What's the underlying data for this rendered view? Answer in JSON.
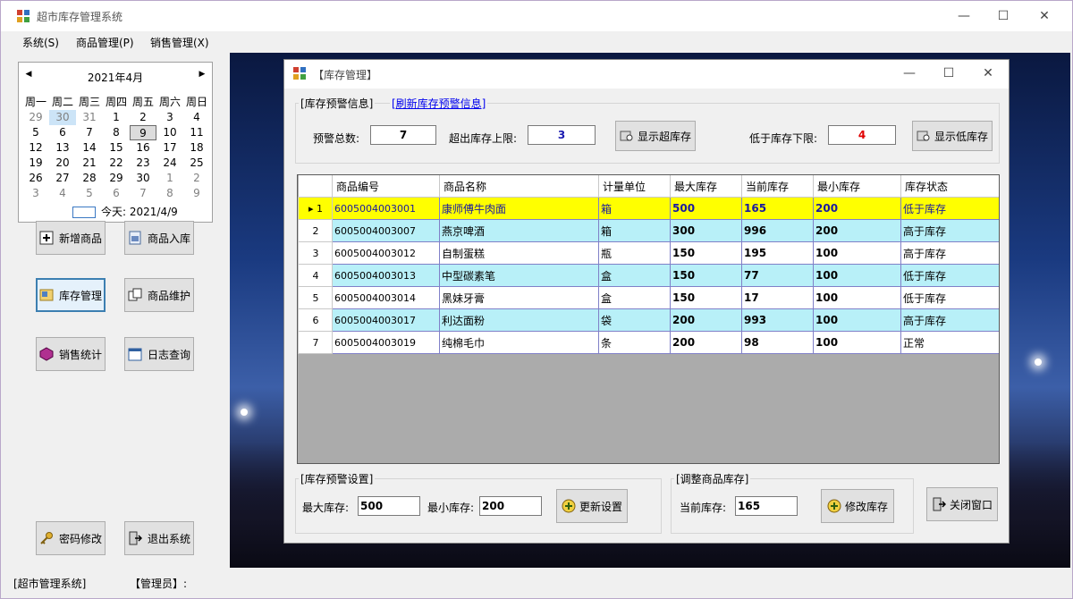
{
  "app": {
    "title": "超市库存管理系统"
  },
  "menu": [
    "系统(S)",
    "商品管理(P)",
    "销售管理(X)"
  ],
  "calendar": {
    "month": "2021年4月",
    "weekdays": [
      "周一",
      "周二",
      "周三",
      "周四",
      "周五",
      "周六",
      "周日"
    ],
    "weeks": [
      [
        "29",
        "30",
        "31",
        "1",
        "2",
        "3",
        "4"
      ],
      [
        "5",
        "6",
        "7",
        "8",
        "9",
        "10",
        "11"
      ],
      [
        "12",
        "13",
        "14",
        "15",
        "16",
        "17",
        "18"
      ],
      [
        "19",
        "20",
        "21",
        "22",
        "23",
        "24",
        "25"
      ],
      [
        "26",
        "27",
        "28",
        "29",
        "30",
        "1",
        "2"
      ],
      [
        "3",
        "4",
        "5",
        "6",
        "7",
        "8",
        "9"
      ]
    ],
    "today": "今天: 2021/4/9"
  },
  "left_buttons": {
    "add": "新增商品",
    "stock_in": "商品入库",
    "inventory": "库存管理",
    "maintain": "商品维护",
    "sales": "销售统计",
    "log": "日志查询",
    "password": "密码修改",
    "exit": "退出系统"
  },
  "status": {
    "system": "[超市管理系统]",
    "admin": "【管理员】:"
  },
  "child": {
    "title": "【库存管理】",
    "warn_group": "[库存预警信息]",
    "refresh_link": "[刷新库存预警信息]",
    "total_label": "预警总数:",
    "total_value": "7",
    "over_label": "超出库存上限:",
    "over_value": "3",
    "show_over": "显示超库存",
    "under_label": "低于库存下限:",
    "under_value": "4",
    "show_under": "显示低库存",
    "settings_group": "[库存预警设置]",
    "max_label": "最大库存:",
    "max_value": "500",
    "min_label": "最小库存:",
    "min_value": "200",
    "update_btn": "更新设置",
    "adjust_group": "[调整商品库存]",
    "current_label": "当前库存:",
    "current_value": "165",
    "modify_btn": "修改库存",
    "close_btn": "关闭窗口"
  },
  "table": {
    "headers": [
      "商品编号",
      "商品名称",
      "计量单位",
      "最大库存",
      "当前库存",
      "最小库存",
      "库存状态"
    ],
    "rows": [
      {
        "n": "1",
        "code": "6005004003001",
        "name": "康师傅牛肉面",
        "unit": "箱",
        "max": "500",
        "cur": "165",
        "min": "200",
        "status": "低于库存"
      },
      {
        "n": "2",
        "code": "6005004003007",
        "name": "燕京啤酒",
        "unit": "箱",
        "max": "300",
        "cur": "996",
        "min": "200",
        "status": "高于库存"
      },
      {
        "n": "3",
        "code": "6005004003012",
        "name": "自制蛋糕",
        "unit": "瓶",
        "max": "150",
        "cur": "195",
        "min": "100",
        "status": "高于库存"
      },
      {
        "n": "4",
        "code": "6005004003013",
        "name": "中型碳素笔",
        "unit": "盒",
        "max": "150",
        "cur": "77",
        "min": "100",
        "status": "低于库存"
      },
      {
        "n": "5",
        "code": "6005004003014",
        "name": "黑妹牙膏",
        "unit": "盒",
        "max": "150",
        "cur": "17",
        "min": "100",
        "status": "低于库存"
      },
      {
        "n": "6",
        "code": "6005004003017",
        "name": "利达面粉",
        "unit": "袋",
        "max": "200",
        "cur": "993",
        "min": "100",
        "status": "高于库存"
      },
      {
        "n": "7",
        "code": "6005004003019",
        "name": "纯棉毛巾",
        "unit": "条",
        "max": "200",
        "cur": "98",
        "min": "100",
        "status": "正常"
      }
    ]
  }
}
